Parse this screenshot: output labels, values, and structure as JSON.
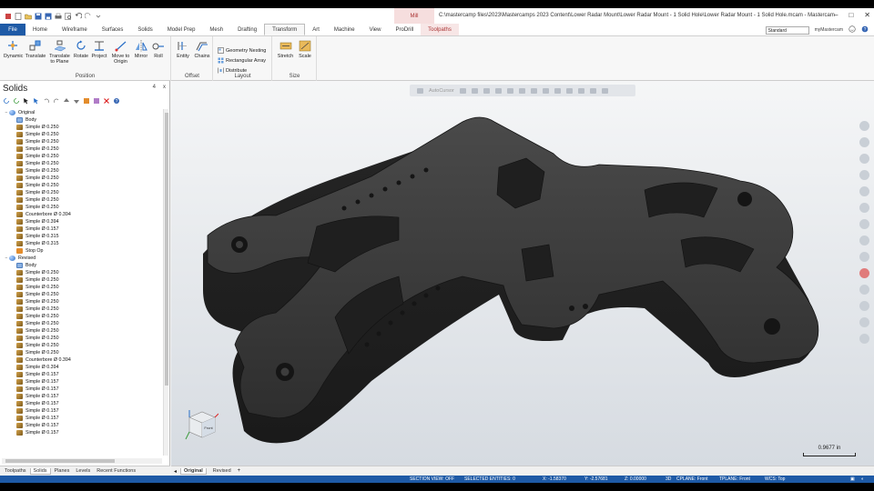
{
  "window": {
    "title": "C:\\mastercamp files\\2023\\Mastercamps 2023 Content\\Lower Radar Mount\\Lower Radar Mount - 1 Solid Hole\\Lower Radar Mount - 1 Solid Hole.mcam - Mastercam",
    "context_tab": "Mill"
  },
  "tabs": [
    "Home",
    "Wireframe",
    "Surfaces",
    "Solids",
    "Model Prep",
    "Mesh",
    "Drafting",
    "Transform",
    "Art",
    "Machine",
    "View",
    "ProDrill"
  ],
  "file_tab": "File",
  "active_tab": "Transform",
  "context_tabs": [
    "Toolpaths"
  ],
  "plane_select": "Standard",
  "account_label": "myMastercam",
  "ribbon": {
    "position": {
      "label": "Position",
      "buttons": [
        "Dynamic",
        "Translate",
        "Translate to Plane",
        "Rotate",
        "Project",
        "Move to Origin",
        "Mirror",
        "Roll"
      ]
    },
    "offset": {
      "label": "Offset",
      "buttons": [
        "Entity",
        "Chains"
      ]
    },
    "layout": {
      "label": "Layout",
      "buttons": [
        "Geometry Nesting",
        "Rectangular Array",
        "Distribute"
      ]
    },
    "size": {
      "label": "Size",
      "buttons": [
        "Stretch",
        "Scale"
      ]
    }
  },
  "panel": {
    "title": "Solids",
    "pin": "4",
    "close": "x",
    "tree": [
      {
        "label": "Original",
        "depth": 1,
        "kind": "solid",
        "exp": "−"
      },
      {
        "label": "Body",
        "depth": 2,
        "kind": "body",
        "exp": ""
      },
      {
        "label": "Simple Ø 0.250",
        "depth": 2,
        "kind": "op",
        "exp": ""
      },
      {
        "label": "Simple Ø 0.250",
        "depth": 2,
        "kind": "op",
        "exp": ""
      },
      {
        "label": "Simple Ø 0.250",
        "depth": 2,
        "kind": "op",
        "exp": ""
      },
      {
        "label": "Simple Ø 0.250",
        "depth": 2,
        "kind": "op",
        "exp": ""
      },
      {
        "label": "Simple Ø 0.250",
        "depth": 2,
        "kind": "op",
        "exp": ""
      },
      {
        "label": "Simple Ø 0.250",
        "depth": 2,
        "kind": "op",
        "exp": ""
      },
      {
        "label": "Simple Ø 0.250",
        "depth": 2,
        "kind": "op",
        "exp": ""
      },
      {
        "label": "Simple Ø 0.250",
        "depth": 2,
        "kind": "op",
        "exp": ""
      },
      {
        "label": "Simple Ø 0.250",
        "depth": 2,
        "kind": "op",
        "exp": ""
      },
      {
        "label": "Simple Ø 0.250",
        "depth": 2,
        "kind": "op",
        "exp": ""
      },
      {
        "label": "Simple Ø 0.250",
        "depth": 2,
        "kind": "op",
        "exp": ""
      },
      {
        "label": "Simple Ø 0.250",
        "depth": 2,
        "kind": "op",
        "exp": ""
      },
      {
        "label": "Counterbore Ø 0.394",
        "depth": 2,
        "kind": "op",
        "exp": ""
      },
      {
        "label": "Simple Ø 0.394",
        "depth": 2,
        "kind": "op",
        "exp": ""
      },
      {
        "label": "Simple Ø 0.157",
        "depth": 2,
        "kind": "op",
        "exp": ""
      },
      {
        "label": "Simple Ø 0.315",
        "depth": 2,
        "kind": "op",
        "exp": ""
      },
      {
        "label": "Simple Ø 0.315",
        "depth": 2,
        "kind": "op",
        "exp": ""
      },
      {
        "label": "Stop Op",
        "depth": 2,
        "kind": "stop",
        "exp": ""
      },
      {
        "label": "Revised",
        "depth": 1,
        "kind": "solid",
        "exp": "−"
      },
      {
        "label": "Body",
        "depth": 2,
        "kind": "body",
        "exp": ""
      },
      {
        "label": "Simple Ø 0.250",
        "depth": 2,
        "kind": "op",
        "exp": ""
      },
      {
        "label": "Simple Ø 0.250",
        "depth": 2,
        "kind": "op",
        "exp": ""
      },
      {
        "label": "Simple Ø 0.250",
        "depth": 2,
        "kind": "op",
        "exp": ""
      },
      {
        "label": "Simple Ø 0.250",
        "depth": 2,
        "kind": "op",
        "exp": ""
      },
      {
        "label": "Simple Ø 0.250",
        "depth": 2,
        "kind": "op",
        "exp": ""
      },
      {
        "label": "Simple Ø 0.250",
        "depth": 2,
        "kind": "op",
        "exp": ""
      },
      {
        "label": "Simple Ø 0.250",
        "depth": 2,
        "kind": "op",
        "exp": ""
      },
      {
        "label": "Simple Ø 0.250",
        "depth": 2,
        "kind": "op",
        "exp": ""
      },
      {
        "label": "Simple Ø 0.250",
        "depth": 2,
        "kind": "op",
        "exp": ""
      },
      {
        "label": "Simple Ø 0.250",
        "depth": 2,
        "kind": "op",
        "exp": ""
      },
      {
        "label": "Simple Ø 0.250",
        "depth": 2,
        "kind": "op",
        "exp": ""
      },
      {
        "label": "Simple Ø 0.250",
        "depth": 2,
        "kind": "op",
        "exp": ""
      },
      {
        "label": "Counterbore Ø 0.394",
        "depth": 2,
        "kind": "op",
        "exp": ""
      },
      {
        "label": "Simple Ø 0.394",
        "depth": 2,
        "kind": "op",
        "exp": ""
      },
      {
        "label": "Simple Ø 0.157",
        "depth": 2,
        "kind": "op",
        "exp": ""
      },
      {
        "label": "Simple Ø 0.157",
        "depth": 2,
        "kind": "op",
        "exp": ""
      },
      {
        "label": "Simple Ø 0.157",
        "depth": 2,
        "kind": "op",
        "exp": ""
      },
      {
        "label": "Simple Ø 0.157",
        "depth": 2,
        "kind": "op",
        "exp": ""
      },
      {
        "label": "Simple Ø 0.157",
        "depth": 2,
        "kind": "op",
        "exp": ""
      },
      {
        "label": "Simple Ø 0.157",
        "depth": 2,
        "kind": "op",
        "exp": ""
      },
      {
        "label": "Simple Ø 0.157",
        "depth": 2,
        "kind": "op",
        "exp": ""
      },
      {
        "label": "Simple Ø 0.157",
        "depth": 2,
        "kind": "op",
        "exp": ""
      },
      {
        "label": "Simple Ø 0.157",
        "depth": 2,
        "kind": "op",
        "exp": ""
      }
    ],
    "bottom_tabs": [
      "Toolpaths",
      "Solids",
      "Planes",
      "Levels",
      "Recent Functions"
    ],
    "active_bottom_tab": "Solids"
  },
  "viewport": {
    "toolbar_text": "AutoCursor",
    "scale_label": "0.9677 in",
    "cube_text": "Front",
    "view_tabs": [
      "Original",
      "Revised"
    ],
    "active_view_tab": "Original",
    "view_tab_more": "+"
  },
  "status": {
    "section_view": "SECTION VIEW: OFF",
    "selected": "SELECTED ENTITIES: 0",
    "x": "X:   -1.58370",
    "y": "Y:   -2.57681",
    "z": "Z:   0.00000",
    "mode": "3D",
    "cplane": "CPLANE: Front",
    "tplane": "TPLANE: Front",
    "wcs": "WCS: Top"
  },
  "colors": {
    "file_tab": "#1e5aa6",
    "status_bar": "#1e5aa6",
    "context_tab": "#f6dede",
    "part": "#3a3a3a"
  }
}
